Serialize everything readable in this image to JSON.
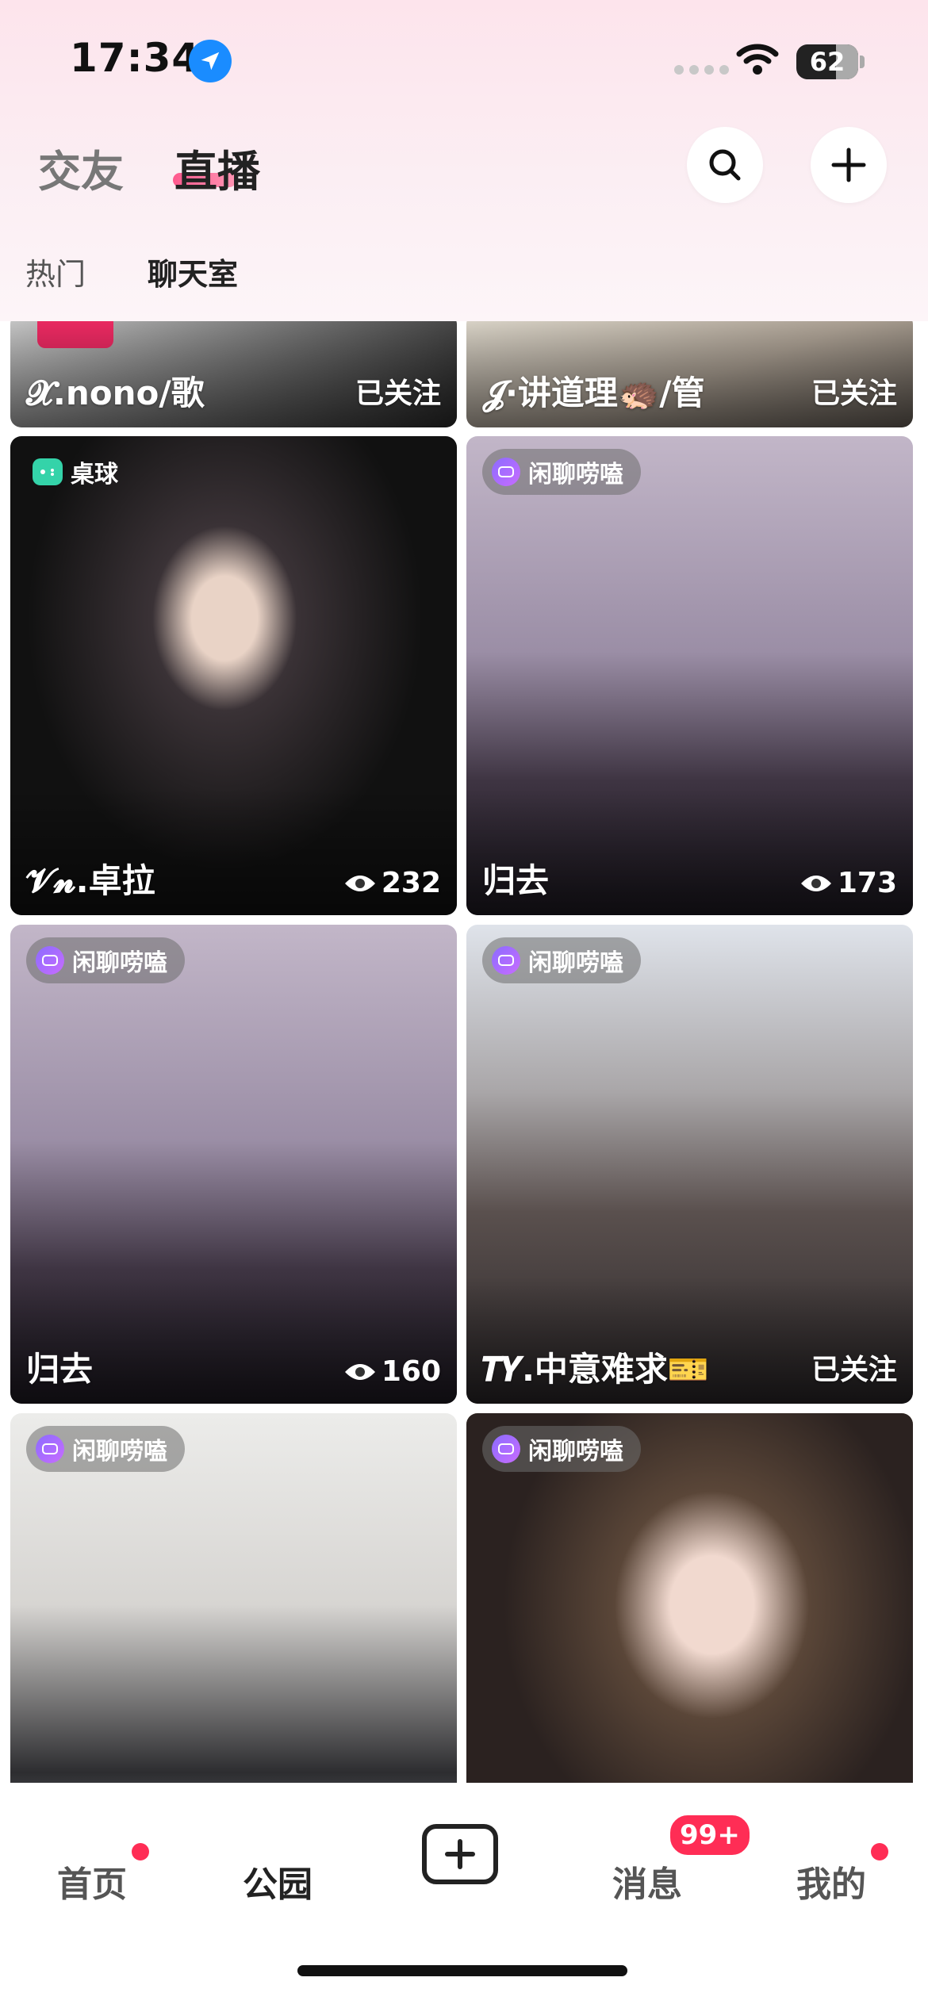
{
  "status_bar": {
    "time": "17:34",
    "battery": "62"
  },
  "header": {
    "tabs": [
      {
        "label": "交友"
      },
      {
        "label": "直播"
      }
    ],
    "active_tab": "直播",
    "sub_tabs": [
      {
        "label": "热门"
      },
      {
        "label": "聊天室"
      }
    ],
    "icons": [
      "search-icon",
      "plus-icon"
    ]
  },
  "cards": [
    {
      "name": "𝓧.nono/歌",
      "right": "已关注",
      "tag": "",
      "views": ""
    },
    {
      "name": "𝓙·讲道理🦔/管",
      "right": "已关注",
      "tag": "",
      "views": ""
    },
    {
      "name": "𝓥𝓷.卓拉",
      "right": "",
      "tag": "桌球",
      "views": "232"
    },
    {
      "name": "归去",
      "right": "",
      "tag": "闲聊唠嗑",
      "views": "173"
    },
    {
      "name": "归去",
      "right": "",
      "tag": "闲聊唠嗑",
      "views": "160"
    },
    {
      "name": "𝑻𝒀.中意难求🎫",
      "right": "已关注",
      "tag": "闲聊唠嗑",
      "views": ""
    },
    {
      "name": "",
      "right": "",
      "tag": "闲聊唠嗑",
      "views": ""
    },
    {
      "name": "",
      "right": "",
      "tag": "闲聊唠嗑",
      "views": ""
    }
  ],
  "bottom_nav": {
    "items": [
      {
        "label": "首页"
      },
      {
        "label": "公园"
      },
      {
        "label": "消息"
      },
      {
        "label": "我的"
      }
    ],
    "message_badge": "99+"
  },
  "colors": {
    "accent": "#ff2d55",
    "location": "#1a8cff"
  }
}
